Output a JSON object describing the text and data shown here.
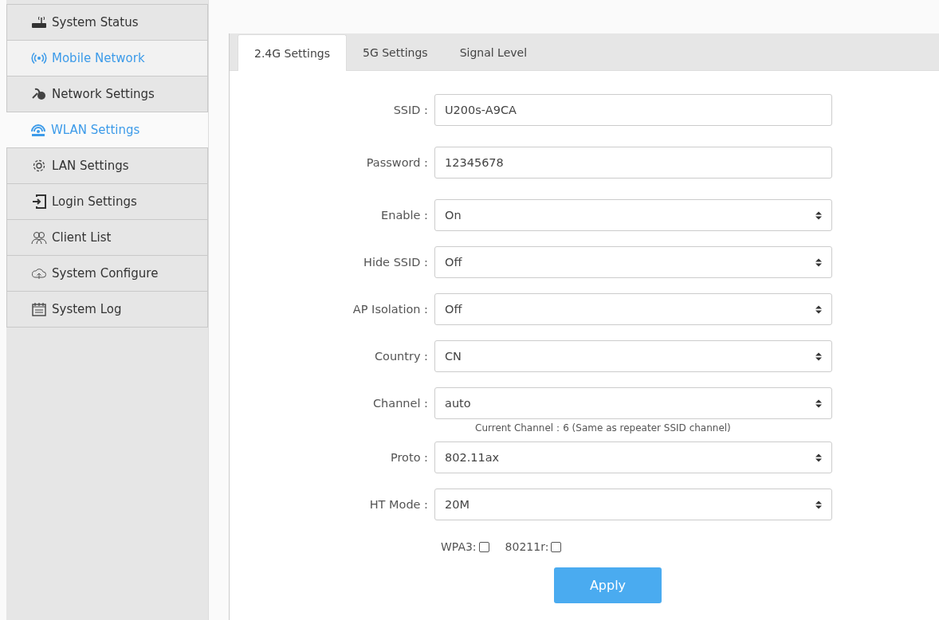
{
  "sidebar": {
    "items": [
      {
        "label": "System Status",
        "selected": false,
        "hovered": false
      },
      {
        "label": "Mobile Network",
        "selected": false,
        "hovered": true
      },
      {
        "label": "Network Settings",
        "selected": false,
        "hovered": false
      },
      {
        "label": "WLAN Settings",
        "selected": true,
        "hovered": false
      },
      {
        "label": "LAN Settings",
        "selected": false,
        "hovered": false
      },
      {
        "label": "Login Settings",
        "selected": false,
        "hovered": false
      },
      {
        "label": "Client List",
        "selected": false,
        "hovered": false
      },
      {
        "label": "System Configure",
        "selected": false,
        "hovered": false
      },
      {
        "label": "System Log",
        "selected": false,
        "hovered": false
      }
    ]
  },
  "tabs": [
    {
      "label": "2.4G Settings",
      "selected": true
    },
    {
      "label": "5G Settings",
      "selected": false
    },
    {
      "label": "Signal Level",
      "selected": false
    }
  ],
  "form": {
    "rows": [
      {
        "kind": "input",
        "label": "SSID :",
        "value": "U200s-A9CA"
      },
      {
        "kind": "input",
        "label": "Password :",
        "value": "12345678"
      },
      {
        "kind": "select",
        "label": "Enable :",
        "value": "On"
      },
      {
        "kind": "select",
        "label": "Hide SSID :",
        "value": "Off"
      },
      {
        "kind": "select",
        "label": "AP Isolation :",
        "value": "Off"
      },
      {
        "kind": "select",
        "label": "Country :",
        "value": "CN"
      },
      {
        "kind": "select",
        "label": "Channel :",
        "value": "auto",
        "hint": "Current Channel：6 (Same as repeater SSID channel)"
      },
      {
        "kind": "select",
        "label": "Proto :",
        "value": "802.11ax"
      },
      {
        "kind": "select",
        "label": "HT Mode :",
        "value": "20M"
      }
    ],
    "checkboxes": [
      {
        "label": "WPA3:",
        "checked": false
      },
      {
        "label": "80211r:",
        "checked": false
      }
    ],
    "apply_button": "Apply"
  }
}
